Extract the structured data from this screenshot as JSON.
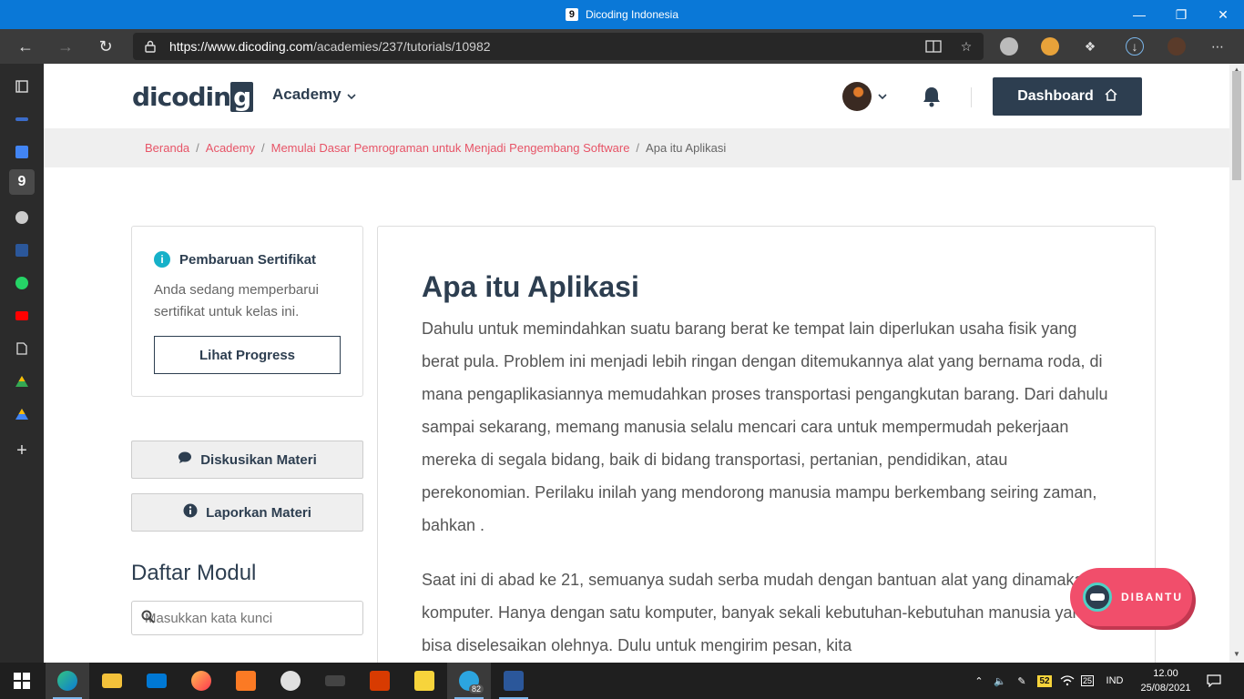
{
  "window": {
    "title": "Dicoding Indonesia",
    "favicon": "9"
  },
  "browser": {
    "url_host": "https://www.dicoding.com",
    "url_path": "/academies/237/tutorials/10982"
  },
  "site": {
    "logo_text": "dicodin",
    "logo_g": "g",
    "nav_academy": "Academy",
    "dashboard_label": "Dashboard"
  },
  "breadcrumb": {
    "items": [
      "Beranda",
      "Academy",
      "Memulai Dasar Pemrograman untuk Menjadi Pengembang Software"
    ],
    "current": "Apa itu Aplikasi",
    "separator": "/"
  },
  "cert": {
    "title": "Pembaruan Sertifikat",
    "description": "Anda sedang memperbarui sertifikat untuk kelas ini.",
    "button": "Lihat Progress"
  },
  "sidebar": {
    "discuss": "Diskusikan Materi",
    "report": "Laporkan Materi",
    "modules_title": "Daftar Modul",
    "search_placeholder": "Masukkan kata kunci"
  },
  "article": {
    "title": "Apa itu Aplikasi",
    "p1": "Dahulu untuk memindahkan suatu barang berat ke tempat lain diperlukan usaha fisik yang berat pula. Problem ini menjadi lebih ringan dengan ditemukannya alat yang bernama roda, di mana pengaplikasiannya memudahkan proses transportasi pengangkutan barang. Dari dahulu sampai sekarang, memang manusia selalu mencari cara untuk mempermudah pekerjaan mereka di segala bidang, baik di bidang transportasi, pertanian, pendidikan, atau perekonomian. Perilaku inilah yang mendorong manusia mampu berkembang seiring zaman, bahkan .",
    "p2": "Saat ini di abad ke 21, semuanya sudah serba mudah dengan bantuan alat yang dinamakan komputer. Hanya dengan satu komputer, banyak sekali kebutuhan-kebutuhan manusia yang bisa diselesaikan olehnya. Dulu untuk mengirim pesan, kita"
  },
  "floating": {
    "label": "DIBANTU"
  },
  "taskbar": {
    "telegram_badge": "82",
    "tray_badge": "52",
    "tray_cal": "25",
    "lang": "IND",
    "time": "12.00",
    "date": "25/08/2021"
  },
  "colors": {
    "titlebar": "#0a78d7",
    "brand_dark": "#2d3e50",
    "link_pink": "#e75467",
    "info_teal": "#16b1c9",
    "dibantu_pink": "#f14e6b"
  }
}
